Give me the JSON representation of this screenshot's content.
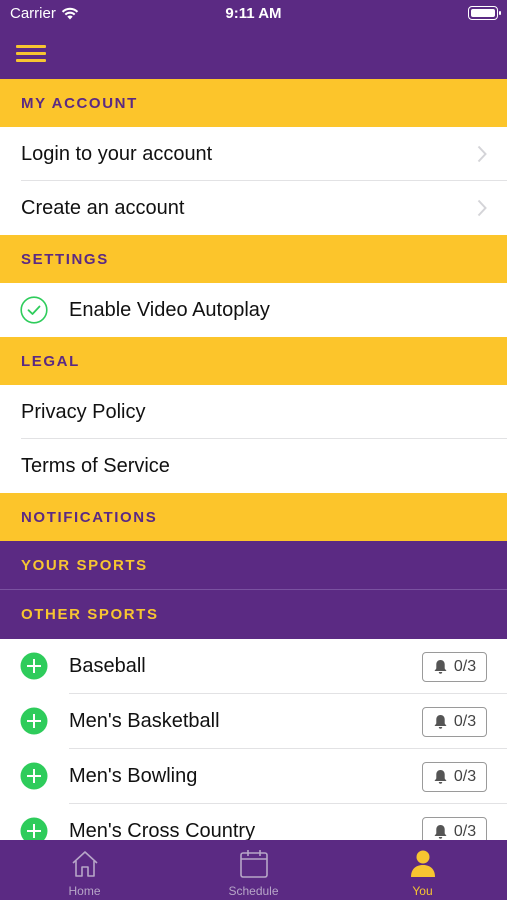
{
  "status_bar": {
    "carrier": "Carrier",
    "time": "9:11 AM"
  },
  "sections": {
    "my_account": {
      "title": "MY ACCOUNT",
      "items": [
        "Login to your account",
        "Create an account"
      ]
    },
    "settings": {
      "title": "SETTINGS",
      "autoplay_label": "Enable Video Autoplay",
      "autoplay_enabled": true
    },
    "legal": {
      "title": "LEGAL",
      "items": [
        "Privacy Policy",
        "Terms of Service"
      ]
    },
    "notifications": {
      "title": "NOTIFICATIONS"
    },
    "your_sports": {
      "title": "YOUR SPORTS"
    },
    "other_sports": {
      "title": "OTHER SPORTS",
      "items": [
        {
          "name": "Baseball",
          "alerts": "0/3"
        },
        {
          "name": "Men's Basketball",
          "alerts": "0/3"
        },
        {
          "name": "Men's Bowling",
          "alerts": "0/3"
        },
        {
          "name": "Men's Cross Country",
          "alerts": "0/3"
        }
      ]
    }
  },
  "tabs": [
    {
      "label": "Home",
      "icon": "home-icon"
    },
    {
      "label": "Schedule",
      "icon": "calendar-icon"
    },
    {
      "label": "You",
      "icon": "person-icon",
      "active": true
    }
  ],
  "colors": {
    "purple": "#5b2a83",
    "gold": "#fcc52b",
    "green": "#2ecc5b"
  }
}
